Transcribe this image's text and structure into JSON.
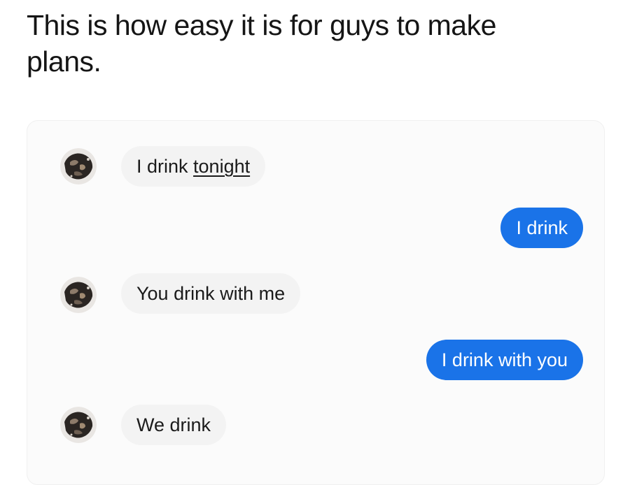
{
  "caption": {
    "line1": "This is how easy it is for guys to make",
    "line2": "plans."
  },
  "messages": [
    {
      "direction": "incoming",
      "text_plain": "I drink ",
      "text_linked": "tonight"
    },
    {
      "direction": "outgoing",
      "text": "I drink"
    },
    {
      "direction": "incoming",
      "text": "You drink with me"
    },
    {
      "direction": "outgoing",
      "text": "I drink with you"
    },
    {
      "direction": "incoming",
      "text": "We drink"
    }
  ],
  "avatar": {
    "icon": "contact-avatar-icon"
  },
  "colors": {
    "outgoing_bubble": "#1a73e8",
    "incoming_bubble": "#f3f3f3",
    "outgoing_text": "#ffffff",
    "incoming_text": "#1b1b1b"
  }
}
